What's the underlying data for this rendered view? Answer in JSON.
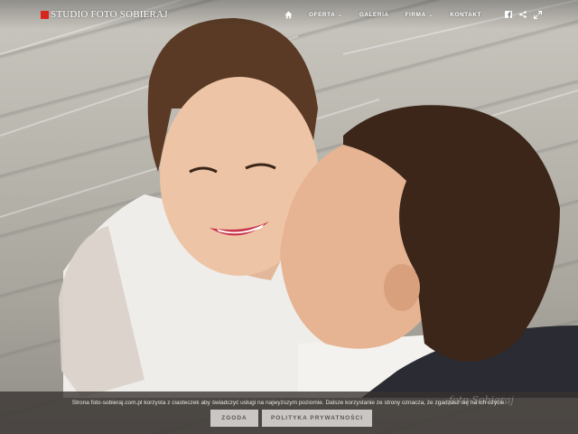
{
  "brand": {
    "name": "STUDIO FOTO SOBIERAJ",
    "accent_color": "#d8261f"
  },
  "nav": {
    "home_icon": "home-icon",
    "items": [
      {
        "label": "OFERTA",
        "has_dropdown": true
      },
      {
        "label": "GALERIA",
        "has_dropdown": false
      },
      {
        "label": "FIRMA",
        "has_dropdown": true
      },
      {
        "label": "KONTAKT",
        "has_dropdown": false
      }
    ],
    "dropdown_glyph": "⌄",
    "social_icons": [
      "facebook-icon",
      "share-icon",
      "fullscreen-icon"
    ]
  },
  "hero": {
    "image_subject": "photo"
  },
  "cookie_bar": {
    "text": "Strona foto-sobieraj.com.pl korzysta z ciasteczek aby świadczyć usługi na najwyższym poziomie. Dalsze korzystanie ze strony oznacza, że zgadzasz się na ich użycie.",
    "accept_label": "ZGODA",
    "policy_label": "POLITYKA PRYWATNOŚCI"
  },
  "watermark": {
    "text": "foto-Sobieraj"
  }
}
